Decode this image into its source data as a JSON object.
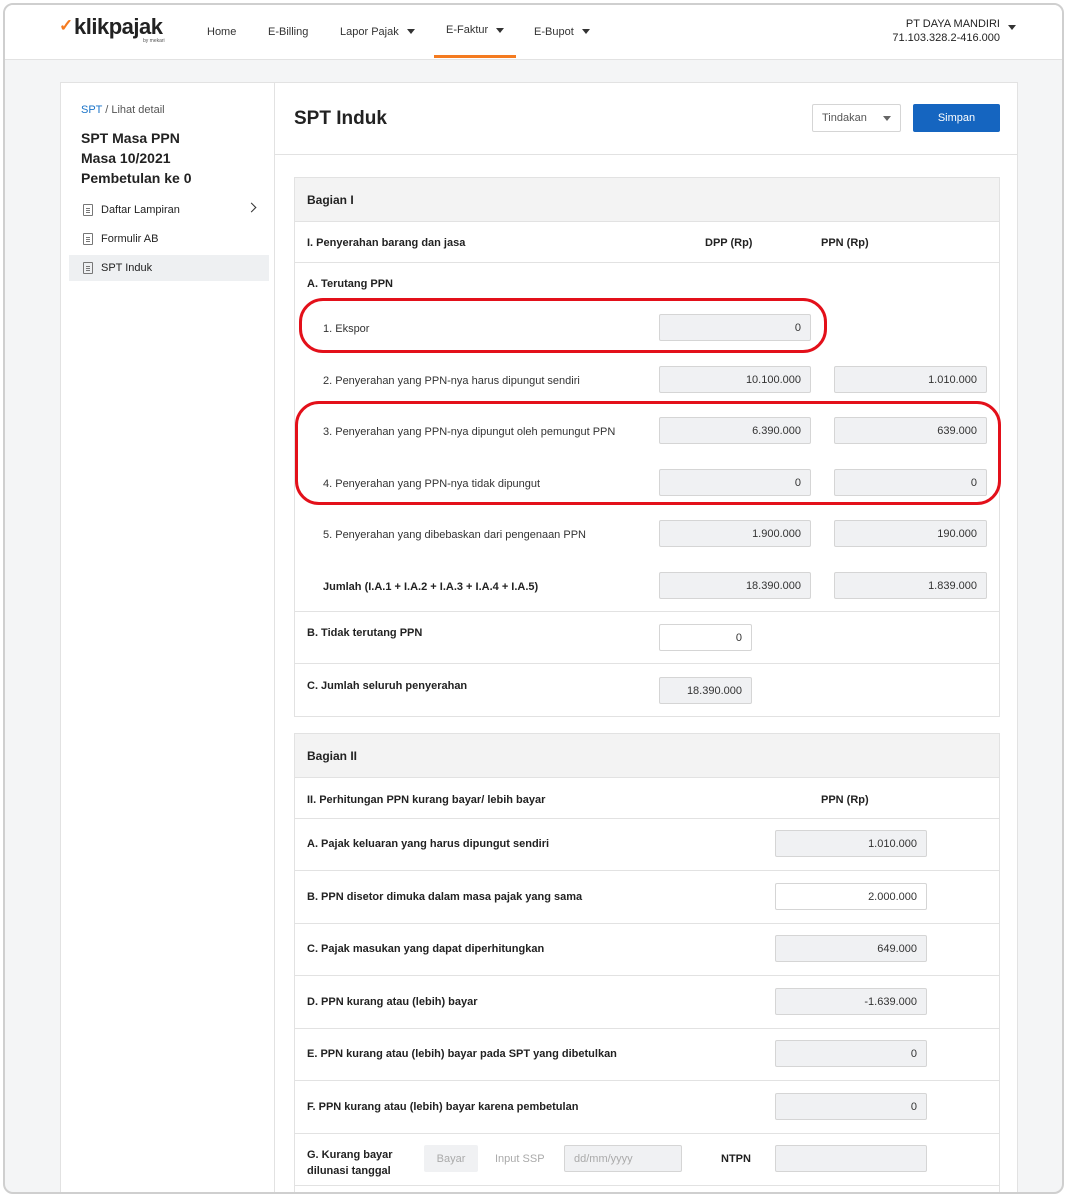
{
  "nav": {
    "logo_text": "klikpajak",
    "logo_sub": "by mekari",
    "items": [
      {
        "label": "Home"
      },
      {
        "label": "E-Billing"
      },
      {
        "label": "Lapor Pajak"
      },
      {
        "label": "E-Faktur"
      },
      {
        "label": "E-Bupot"
      }
    ],
    "company_name": "PT DAYA MANDIRI",
    "company_npwp": "71.103.328.2-416.000",
    "accent": "#f47b20"
  },
  "sidebar": {
    "crumb_link": "SPT",
    "crumb_rest": " / Lihat detail",
    "title_line1": "SPT Masa PPN",
    "title_line2": "Masa 10/2021",
    "title_line3": "Pembetulan ke 0",
    "items": [
      {
        "label": "Daftar Lampiran"
      },
      {
        "label": "Formulir AB"
      },
      {
        "label": "SPT Induk"
      }
    ]
  },
  "main": {
    "title": "SPT Induk",
    "action_label": "Tindakan",
    "save_label": "Simpan",
    "primary_color": "#1565c0"
  },
  "bagian1": {
    "title": "Bagian I",
    "heading": "I. Penyerahan barang dan jasa",
    "col_dpp": "DPP (Rp)",
    "col_ppn": "PPN (Rp)",
    "a_title": "A. Terutang PPN",
    "rows": [
      {
        "label": "1. Ekspor",
        "dpp": "0",
        "ppn": ""
      },
      {
        "label": "2. Penyerahan yang PPN-nya harus dipungut sendiri",
        "dpp": "10.100.000",
        "ppn": "1.010.000"
      },
      {
        "label": "3. Penyerahan yang PPN-nya dipungut oleh pemungut PPN",
        "dpp": "6.390.000",
        "ppn": "639.000"
      },
      {
        "label": "4. Penyerahan yang PPN-nya tidak dipungut",
        "dpp": "0",
        "ppn": "0"
      },
      {
        "label": "5. Penyerahan yang dibebaskan dari pengenaan PPN",
        "dpp": "1.900.000",
        "ppn": "190.000"
      }
    ],
    "jumlah_label": "Jumlah (I.A.1 + I.A.2 + I.A.3 + I.A.4 + I.A.5)",
    "jumlah_dpp": "18.390.000",
    "jumlah_ppn": "1.839.000",
    "b_label": "B. Tidak terutang PPN",
    "b_value": "0",
    "c_label": "C. Jumlah seluruh penyerahan",
    "c_value": "18.390.000"
  },
  "bagian2": {
    "title": "Bagian II",
    "heading": "II. Perhitungan PPN kurang bayar/ lebih bayar",
    "col_ppn": "PPN (Rp)",
    "rows": [
      {
        "label": "A. Pajak keluaran yang harus dipungut sendiri",
        "value": "1.010.000"
      },
      {
        "label": "B. PPN disetor dimuka dalam masa pajak yang sama",
        "value": "2.000.000"
      },
      {
        "label": "C. Pajak masukan yang dapat diperhitungkan",
        "value": "649.000"
      },
      {
        "label": "D. PPN kurang atau (lebih) bayar",
        "value": "-1.639.000"
      },
      {
        "label": "E. PPN kurang atau (lebih) bayar pada SPT yang dibetulkan",
        "value": "0"
      },
      {
        "label": "F. PPN kurang atau (lebih) bayar karena pembetulan",
        "value": "0"
      }
    ],
    "g_label_line1": "G. Kurang bayar",
    "g_label_line2": "dilunasi tanggal",
    "bayar_label": "Bayar",
    "input_ssp_label": "Input SSP",
    "date_placeholder": "dd/mm/yyyy",
    "ntpn_label": "NTPN",
    "ntpn_value": ""
  },
  "annotation_color": "#e3101a"
}
